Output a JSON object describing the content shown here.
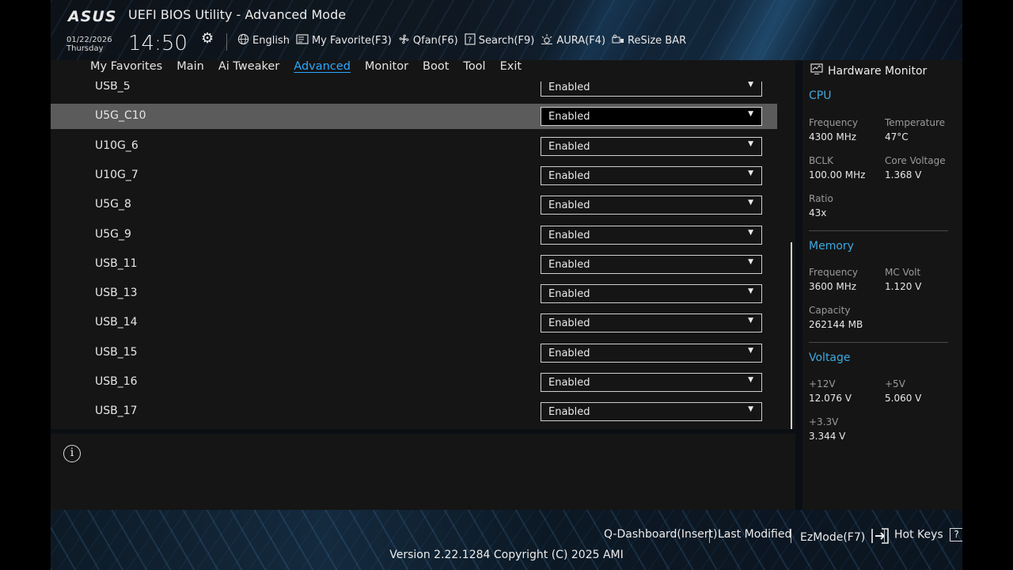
{
  "header": {
    "logo": "ASUS",
    "title": "UEFI BIOS Utility - Advanced Mode",
    "date": "01/22/2026",
    "weekday": "Thursday",
    "time": "14:50"
  },
  "toolbar": {
    "language": "English",
    "my_favorite": "My Favorite(F3)",
    "qfan": "Qfan(F6)",
    "search": "Search(F9)",
    "aura": "AURA(F4)",
    "resize_bar": "ReSize BAR"
  },
  "nav": {
    "tabs": [
      "My Favorites",
      "Main",
      "Ai Tweaker",
      "Advanced",
      "Monitor",
      "Boot",
      "Tool",
      "Exit"
    ],
    "active": "Advanced"
  },
  "settings": {
    "rows": [
      {
        "label": "USB_5",
        "value": "Enabled"
      },
      {
        "label": "U5G_C10",
        "value": "Enabled"
      },
      {
        "label": "U10G_6",
        "value": "Enabled"
      },
      {
        "label": "U10G_7",
        "value": "Enabled"
      },
      {
        "label": "U5G_8",
        "value": "Enabled"
      },
      {
        "label": "U5G_9",
        "value": "Enabled"
      },
      {
        "label": "USB_11",
        "value": "Enabled"
      },
      {
        "label": "USB_13",
        "value": "Enabled"
      },
      {
        "label": "USB_14",
        "value": "Enabled"
      },
      {
        "label": "USB_15",
        "value": "Enabled"
      },
      {
        "label": "USB_16",
        "value": "Enabled"
      },
      {
        "label": "USB_17",
        "value": "Enabled"
      }
    ],
    "selected_label": "U5G_C10"
  },
  "hardware_monitor": {
    "title": "Hardware Monitor",
    "cpu": {
      "heading": "CPU",
      "frequency_label": "Frequency",
      "frequency": "4300 MHz",
      "temperature_label": "Temperature",
      "temperature": "47°C",
      "bclk_label": "BCLK",
      "bclk": "100.00 MHz",
      "core_voltage_label": "Core Voltage",
      "core_voltage": "1.368 V",
      "ratio_label": "Ratio",
      "ratio": "43x"
    },
    "memory": {
      "heading": "Memory",
      "frequency_label": "Frequency",
      "frequency": "3600 MHz",
      "mc_volt_label": "MC Volt",
      "mc_volt": "1.120 V",
      "capacity_label": "Capacity",
      "capacity": "262144 MB"
    },
    "voltage": {
      "heading": "Voltage",
      "v12_label": "+12V",
      "v12": "12.076 V",
      "v5_label": "+5V",
      "v5": "5.060 V",
      "v33_label": "+3.3V",
      "v33": "3.344 V"
    }
  },
  "footer": {
    "q_dashboard": "Q-Dashboard(Insert)",
    "last_modified": "Last Modified",
    "ezmode": "EzMode(F7)",
    "hot_keys": "Hot Keys",
    "hot_keys_key": "?",
    "version": "Version 2.22.1284 Copyright (C) 2025 AMI"
  },
  "colors": {
    "accent": "#2aa9ff",
    "section_heading": "#3fa9e0",
    "panel_bg": "#151515",
    "selected_row": "#5b5b5b"
  },
  "icons": [
    "gear-icon",
    "globe-icon",
    "favorite-icon",
    "fan-icon",
    "search-icon",
    "aura-icon",
    "resize-bar-icon",
    "info-icon",
    "monitor-icon",
    "exit-icon",
    "help-icon",
    "chevron-down-icon"
  ]
}
